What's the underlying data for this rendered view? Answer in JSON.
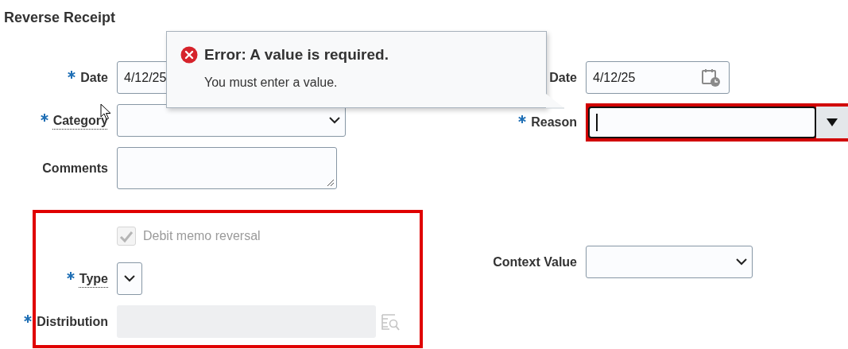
{
  "title": "Reverse Receipt",
  "left_fields": [
    {
      "kind": "date",
      "label": "Date",
      "required": true,
      "value": "4/12/25"
    },
    {
      "kind": "select",
      "label": "Category",
      "required": true,
      "hint": true
    },
    {
      "kind": "textarea",
      "label": "Comments",
      "required": false
    }
  ],
  "options": [
    {
      "kind": "checkbox",
      "label": "Debit memo reversal",
      "checked": true,
      "disabled": true
    },
    {
      "kind": "select",
      "label": "Type",
      "required": true,
      "hint": true
    },
    {
      "kind": "lookup",
      "label": "Distribution",
      "required": true,
      "disabled": true
    }
  ],
  "right_fields": [
    {
      "kind": "date",
      "label": "Date",
      "value": "4/12/25"
    },
    {
      "kind": "combo",
      "label": "Reason",
      "required": true,
      "error": true
    },
    {
      "kind": "select",
      "label": "Context Value",
      "required": false
    }
  ],
  "error_popup": {
    "title": "Error: A value is required.",
    "message": "You must enter a value."
  }
}
